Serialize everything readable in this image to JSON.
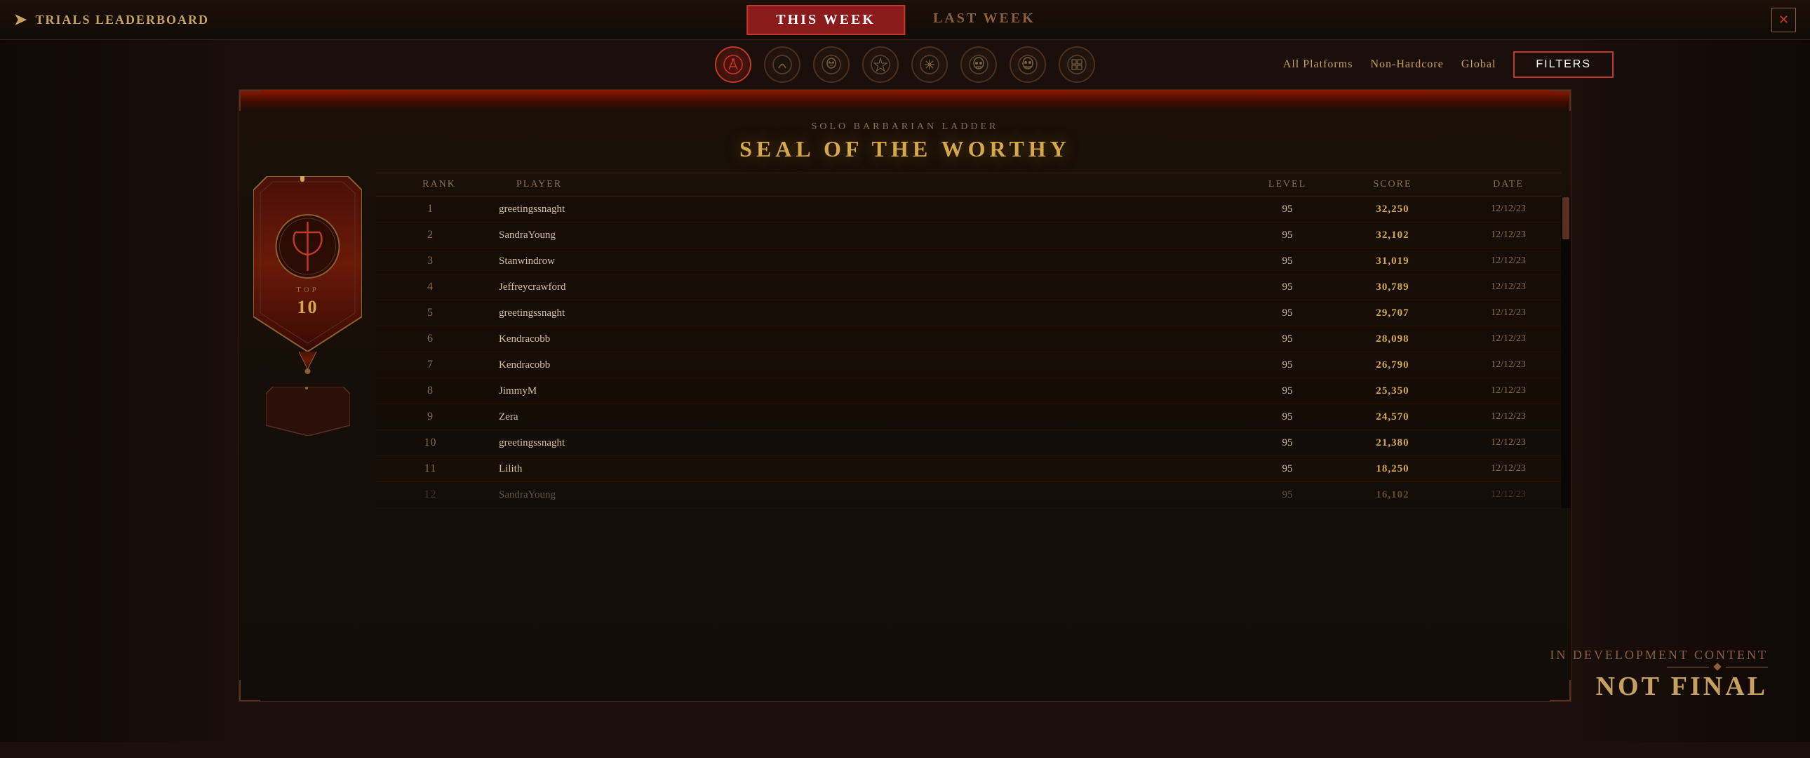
{
  "app": {
    "title": "TRIALS LEADERBOARD"
  },
  "header": {
    "tabs": [
      {
        "id": "this-week",
        "label": "THIS WEEK",
        "active": true
      },
      {
        "id": "last-week",
        "label": "LAST WEEK",
        "active": false
      }
    ],
    "filters": {
      "platform": "All Platforms",
      "mode": "Non-Hardcore",
      "scope": "Global",
      "button": "Filters"
    }
  },
  "ladder": {
    "subtitle": "SOLO BARBARIAN LADDER",
    "title": "SEAL OF THE WORTHY",
    "columns": {
      "rank": "Rank",
      "player": "Player",
      "level": "Level",
      "score": "Score",
      "date": "Date"
    }
  },
  "rows": [
    {
      "rank": "1",
      "player": "greetingssnaght",
      "level": "95",
      "score": "32,250",
      "date": "12/12/23",
      "top10": true
    },
    {
      "rank": "2",
      "player": "SandraYoung",
      "level": "95",
      "score": "32,102",
      "date": "12/12/23",
      "top10": true
    },
    {
      "rank": "3",
      "player": "Stanwindrow",
      "level": "95",
      "score": "31,019",
      "date": "12/12/23",
      "top10": true
    },
    {
      "rank": "4",
      "player": "Jeffreycrawford",
      "level": "95",
      "score": "30,789",
      "date": "12/12/23",
      "top10": true
    },
    {
      "rank": "5",
      "player": "greetingssnaght",
      "level": "95",
      "score": "29,707",
      "date": "12/12/23",
      "top10": true
    },
    {
      "rank": "6",
      "player": "Kendracobb",
      "level": "95",
      "score": "28,098",
      "date": "12/12/23",
      "top10": true
    },
    {
      "rank": "7",
      "player": "Kendracobb",
      "level": "95",
      "score": "26,790",
      "date": "12/12/23",
      "top10": true
    },
    {
      "rank": "8",
      "player": "JimmyM",
      "level": "95",
      "score": "25,350",
      "date": "12/12/23",
      "top10": true
    },
    {
      "rank": "9",
      "player": "Zera",
      "level": "95",
      "score": "24,570",
      "date": "12/12/23",
      "top10": true
    },
    {
      "rank": "10",
      "player": "greetingssnaght",
      "level": "95",
      "score": "21,380",
      "date": "12/12/23",
      "top10": true
    },
    {
      "rank": "11",
      "player": "Lilith",
      "level": "95",
      "score": "18,250",
      "date": "12/12/23",
      "top10": false
    },
    {
      "rank": "12",
      "player": "SandraYoung",
      "level": "95",
      "score": "16,102",
      "date": "12/12/23",
      "top10": false,
      "partial": true
    }
  ],
  "dev_notice": {
    "top_line": "IN DEVELOPMENT CONTENT",
    "bottom_line": "NOT FINAL"
  },
  "classes": [
    {
      "id": "barbarian",
      "name": "Barbarian",
      "selected": true
    },
    {
      "id": "druid",
      "name": "Druid",
      "selected": false
    },
    {
      "id": "necromancer",
      "name": "Necromancer",
      "selected": false
    },
    {
      "id": "sorceress",
      "name": "Sorceress",
      "selected": false
    },
    {
      "id": "rogue",
      "name": "Rogue",
      "selected": false
    },
    {
      "id": "skull1",
      "name": "Class6",
      "selected": false
    },
    {
      "id": "skull2",
      "name": "Class7",
      "selected": false
    },
    {
      "id": "pattern",
      "name": "Class8",
      "selected": false
    }
  ]
}
